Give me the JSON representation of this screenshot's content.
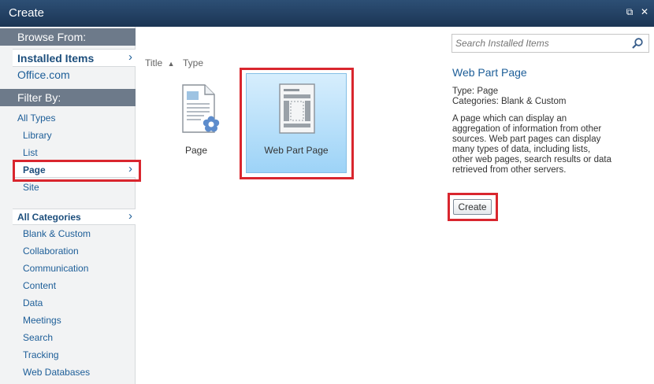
{
  "window": {
    "title": "Create",
    "restore_glyph": "⧉",
    "close_glyph": "✕"
  },
  "left": {
    "browse_heading": "Browse From:",
    "installed_items": "Installed Items",
    "office_com": "Office.com",
    "filter_heading": "Filter By:",
    "types": [
      "All Types",
      "Library",
      "List",
      "Page",
      "Site"
    ],
    "selected_type": "Page",
    "all_categories": "All Categories",
    "categories": [
      "Blank & Custom",
      "Collaboration",
      "Communication",
      "Content",
      "Data",
      "Meetings",
      "Search",
      "Tracking",
      "Web Databases"
    ]
  },
  "middle": {
    "sort_title": "Title",
    "sort_type": "Type",
    "items": [
      {
        "label": "Page",
        "icon": "page-icon",
        "selected": false
      },
      {
        "label": "Web Part Page",
        "icon": "web-part-page-icon",
        "selected": true
      }
    ]
  },
  "right": {
    "search_placeholder": "Search Installed Items",
    "detail_title": "Web Part Page",
    "type_line": "Type: Page",
    "categories_line": "Categories: Blank & Custom",
    "description_lines": [
      "A page which can display an",
      "aggregation of information from other",
      "sources. Web part pages can display",
      "many types of data, including lists,",
      "other web pages, search results or data",
      "retrieved from other servers."
    ],
    "create_label": "Create"
  },
  "colors": {
    "highlight_red": "#d9262e",
    "link_blue": "#1d5e98",
    "selected_tile": "#a9d8f7",
    "titlebar": "#1b3554"
  }
}
